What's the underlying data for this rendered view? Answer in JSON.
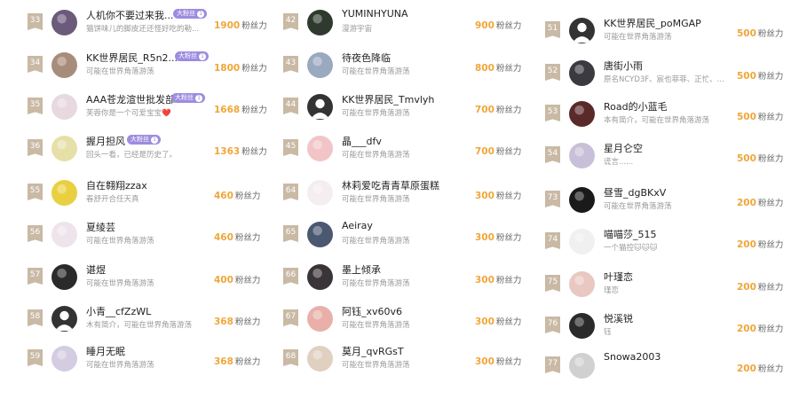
{
  "fans_unit": "粉丝力",
  "badge_label": "大粉丝",
  "badge_level": "1",
  "columns": [
    [
      {
        "rank": "33",
        "name": "人机你不要过来我...",
        "desc": "猫饼味儿的脚皮还还怪好吃的勒...",
        "fans": "1900",
        "badge": true,
        "avatar": "#6b5a7a"
      },
      {
        "rank": "34",
        "name": "KK世界居民_R5n2...",
        "desc": "可能在世界角落游荡",
        "fans": "1800",
        "badge": true,
        "avatar": "#a88c7a"
      },
      {
        "rank": "35",
        "name": "AAA苍龙渲世批发部",
        "desc": "芙蓉你是一个可爱宝宝❤️",
        "fans": "1668",
        "badge": true,
        "avatar": "#e8d8e0"
      },
      {
        "rank": "36",
        "name": "握月担风",
        "desc": "回头一看，已经是历史了。",
        "fans": "1363",
        "badge": true,
        "avatar": "#e6e0a8"
      },
      {
        "rank": "55",
        "name": "自在翱翔zzax",
        "desc": "春舒开合任天真",
        "fans": "460",
        "badge": false,
        "avatar": "#e8d040"
      },
      {
        "rank": "56",
        "name": "夏绫芸",
        "desc": "可能在世界角落游荡",
        "fans": "460",
        "badge": false,
        "avatar": "#f0e4ec"
      },
      {
        "rank": "57",
        "name": "谌煜",
        "desc": "可能在世界角落游荡",
        "fans": "400",
        "badge": false,
        "avatar": "#2a2a2a"
      },
      {
        "rank": "58",
        "name": "小青__cfZzWL",
        "desc": "木有简介，可能在世界角落游荡",
        "fans": "368",
        "badge": false,
        "avatar": "gray"
      },
      {
        "rank": "59",
        "name": "睡月无眠",
        "desc": "可能在世界角落游荡",
        "fans": "368",
        "badge": false,
        "avatar": "#d4cce0"
      }
    ],
    [
      {
        "rank": "42",
        "name": "YUMINHYUNA",
        "desc": "漫游宇宙",
        "fans": "900",
        "badge": false,
        "avatar": "#2e3a2e"
      },
      {
        "rank": "43",
        "name": "待夜色降临",
        "desc": "可能在世界角落游荡",
        "fans": "800",
        "badge": false,
        "avatar": "#9aa8c0"
      },
      {
        "rank": "44",
        "name": "KK世界居民_Tmvlyh",
        "desc": "可能在世界角落游荡",
        "fans": "700",
        "badge": false,
        "avatar": "gray"
      },
      {
        "rank": "45",
        "name": "晶___dfv",
        "desc": "可能在世界角落游荡",
        "fans": "700",
        "badge": false,
        "avatar": "#f2c4c8"
      },
      {
        "rank": "64",
        "name": "林莉爱吃青青草原蛋糕",
        "desc": "可能在世界角落游荡",
        "fans": "300",
        "badge": false,
        "avatar": "#f4eef0"
      },
      {
        "rank": "65",
        "name": "Aeiray",
        "desc": "可能在世界角落游荡",
        "fans": "300",
        "badge": false,
        "avatar": "#4a5870"
      },
      {
        "rank": "66",
        "name": "墨上倾承",
        "desc": "可能在世界角落游荡",
        "fans": "300",
        "badge": false,
        "avatar": "#3a3438"
      },
      {
        "rank": "67",
        "name": "阿钰_xv60v6",
        "desc": "可能在世界角落游荡",
        "fans": "300",
        "badge": false,
        "avatar": "#e8b0a8"
      },
      {
        "rank": "68",
        "name": "莫月_qvRGsT",
        "desc": "可能在世界角落游荡",
        "fans": "300",
        "badge": false,
        "avatar": "#e0d0c0"
      }
    ],
    [
      {
        "rank": "51",
        "name": "KK世界居民_poMGAP",
        "desc": "可能在世界角落游荡",
        "fans": "500",
        "badge": false,
        "avatar": "gray"
      },
      {
        "rank": "52",
        "name": "唐街小雨",
        "desc": "原名NCYD3F、宸也菲菲、正忙、...",
        "fans": "500",
        "badge": false,
        "avatar": "#3a3a40"
      },
      {
        "rank": "53",
        "name": "Road的小蓝毛",
        "desc": "本有简介，可能在世界角落游荡",
        "fans": "500",
        "badge": false,
        "avatar": "#5a2a2a"
      },
      {
        "rank": "54",
        "name": "星月仑空",
        "desc": "谎言......",
        "fans": "500",
        "badge": false,
        "avatar": "#c8c0d8"
      },
      {
        "rank": "73",
        "name": "昼雪_dgBKxV",
        "desc": "可能在世界角落游荡",
        "fans": "200",
        "badge": false,
        "avatar": "#1a1a1a"
      },
      {
        "rank": "74",
        "name": "喵喵莎_515",
        "desc": "一个猫控🐱🐱🐱",
        "fans": "200",
        "badge": false,
        "avatar": "#f0f0f0"
      },
      {
        "rank": "75",
        "name": "叶瑾恋",
        "desc": "瑾恋",
        "fans": "200",
        "badge": false,
        "avatar": "#e8c8c0"
      },
      {
        "rank": "76",
        "name": "悦溪锐",
        "desc": "钰",
        "fans": "200",
        "badge": false,
        "avatar": "#2a2a2a"
      },
      {
        "rank": "77",
        "name": "Snowa2003",
        "desc": "",
        "fans": "200",
        "badge": false,
        "avatar": "#d0d0d0"
      }
    ]
  ]
}
